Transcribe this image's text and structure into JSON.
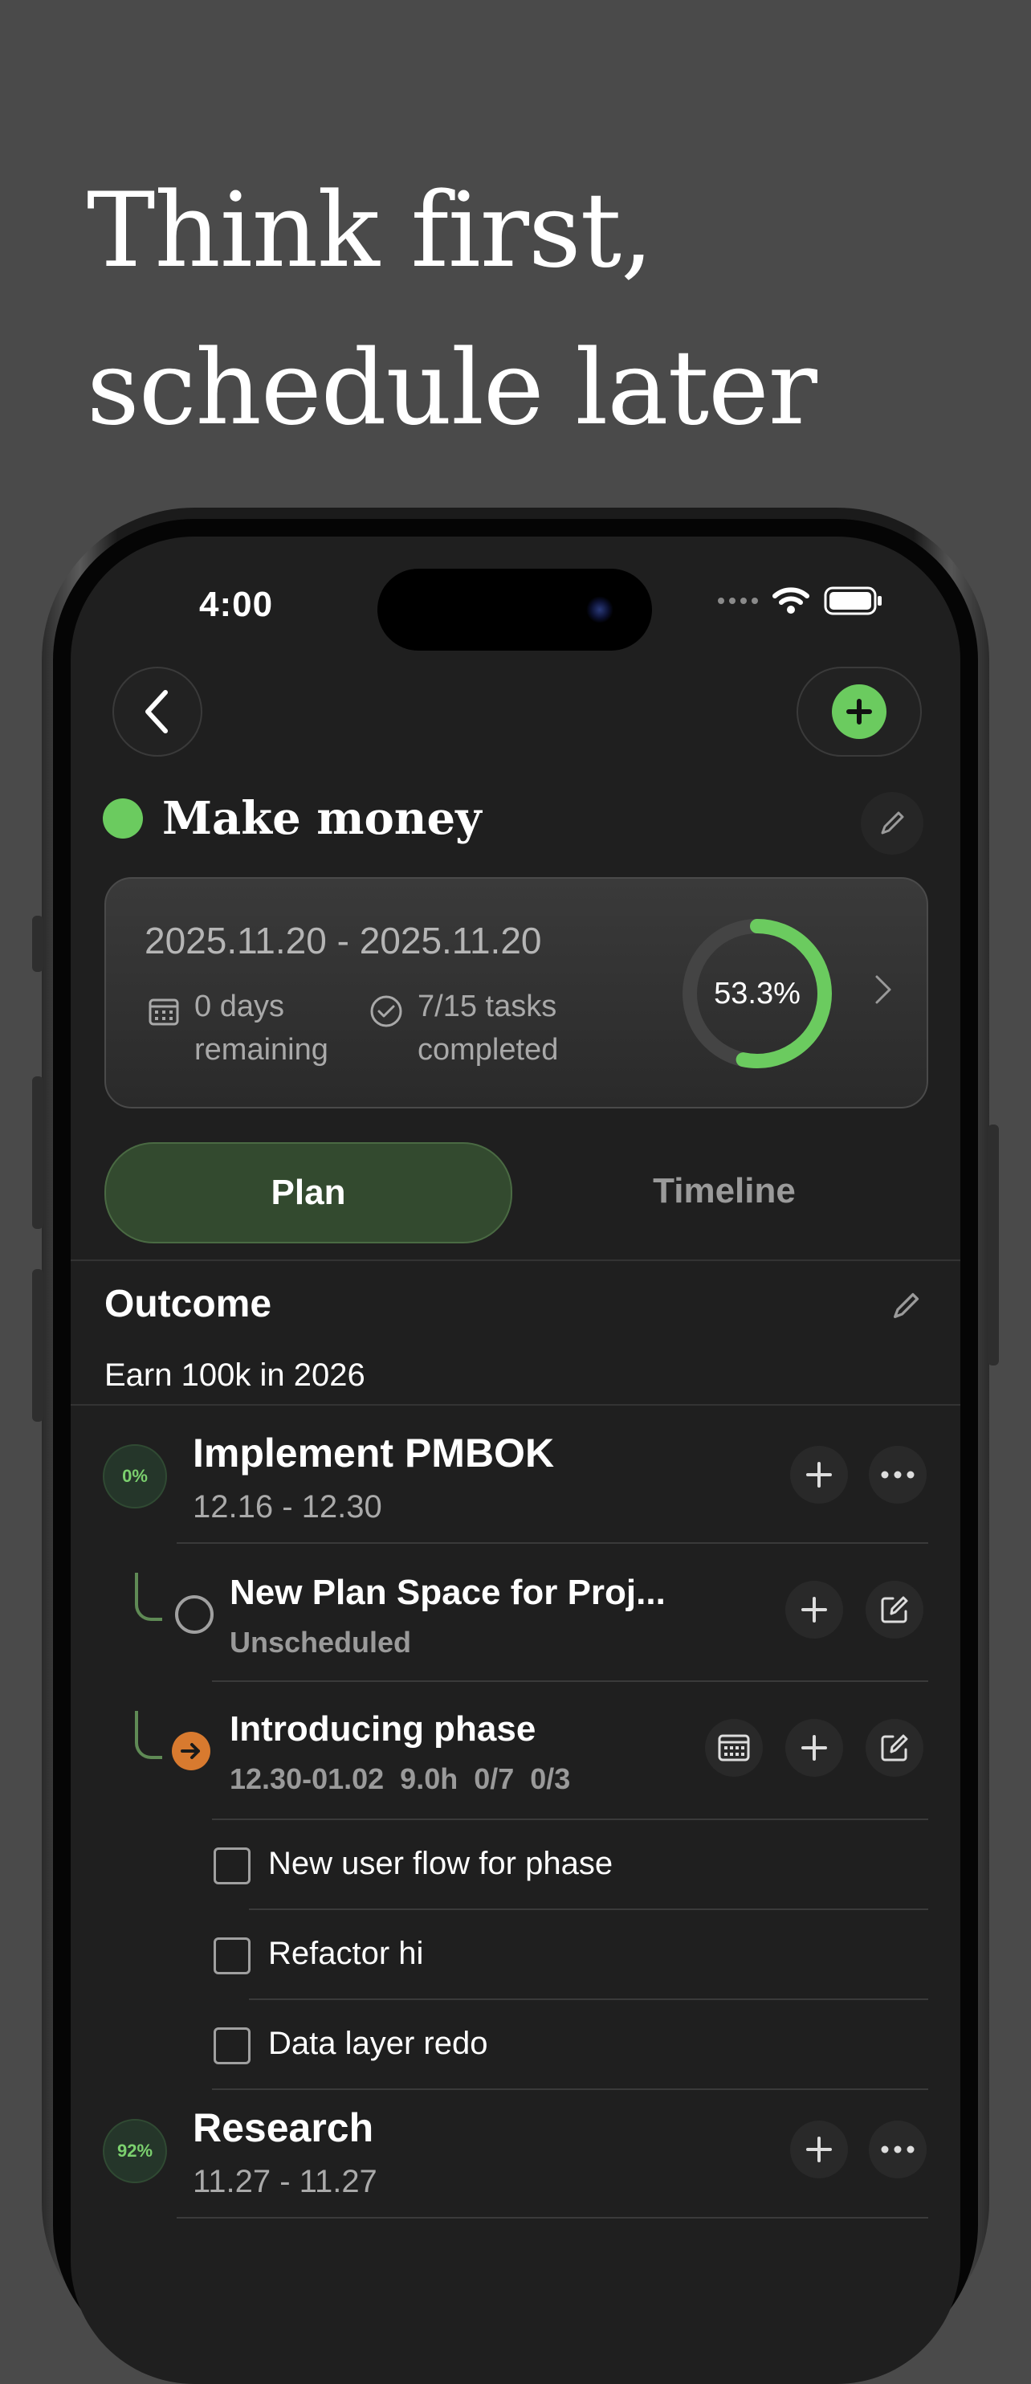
{
  "headline": {
    "line1": "Think first,",
    "line2": "schedule later"
  },
  "status_bar": {
    "time": "4:00"
  },
  "goal": {
    "title": "Make money",
    "color": "#6bcb5f"
  },
  "summary": {
    "date_range": "2025.11.20 - 2025.11.20",
    "days_line1": "0 days",
    "days_line2": "remaining",
    "tasks_line1": "7/15 tasks",
    "tasks_line2": "completed",
    "progress_label": "53.3%",
    "progress_value": 0.533
  },
  "tabs": {
    "plan": "Plan",
    "timeline": "Timeline",
    "selected": "Plan"
  },
  "outcome": {
    "title": "Outcome",
    "text": "Earn 100k in 2026"
  },
  "groups": [
    {
      "badge": "0%",
      "title": "Implement PMBOK",
      "dates": "12.16 - 12.30",
      "tasks": [
        {
          "title": "New Plan Space for Proj...",
          "subtitle": "Unscheduled",
          "status": "open"
        },
        {
          "title": "Introducing phase",
          "subtitle": "12.30-01.02  9.0h  0/7  0/3",
          "status": "in-progress"
        }
      ],
      "checklist": [
        "New user flow for phase",
        "Refactor hi",
        "Data layer redo"
      ]
    },
    {
      "badge": "92%",
      "title": "Research",
      "dates": "11.27 - 11.27"
    }
  ],
  "colors": {
    "accent": "#6bcb5f",
    "background": "#1f1f1f",
    "orange": "#d87a2f"
  }
}
